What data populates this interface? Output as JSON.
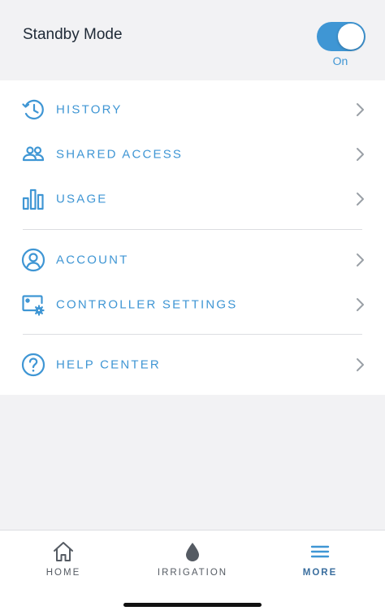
{
  "standby": {
    "title": "Standby Mode",
    "toggle_state": "On",
    "enabled": true
  },
  "menu": {
    "items": [
      {
        "label": "HISTORY",
        "icon": "history-icon"
      },
      {
        "label": "SHARED ACCESS",
        "icon": "people-icon"
      },
      {
        "label": "USAGE",
        "icon": "bar-chart-icon"
      },
      {
        "label": "ACCOUNT",
        "icon": "user-circle-icon"
      },
      {
        "label": "CONTROLLER SETTINGS",
        "icon": "controller-gear-icon"
      },
      {
        "label": "HELP CENTER",
        "icon": "question-circle-icon"
      }
    ]
  },
  "tabbar": {
    "tabs": [
      {
        "label": "HOME",
        "icon": "home-icon",
        "active": false
      },
      {
        "label": "IRRIGATION",
        "icon": "water-drop-icon",
        "active": false
      },
      {
        "label": "MORE",
        "icon": "menu-icon",
        "active": true
      }
    ]
  },
  "colors": {
    "accent": "#3f96d4",
    "active_tab": "#3a6e9e",
    "background": "#f2f2f4"
  }
}
